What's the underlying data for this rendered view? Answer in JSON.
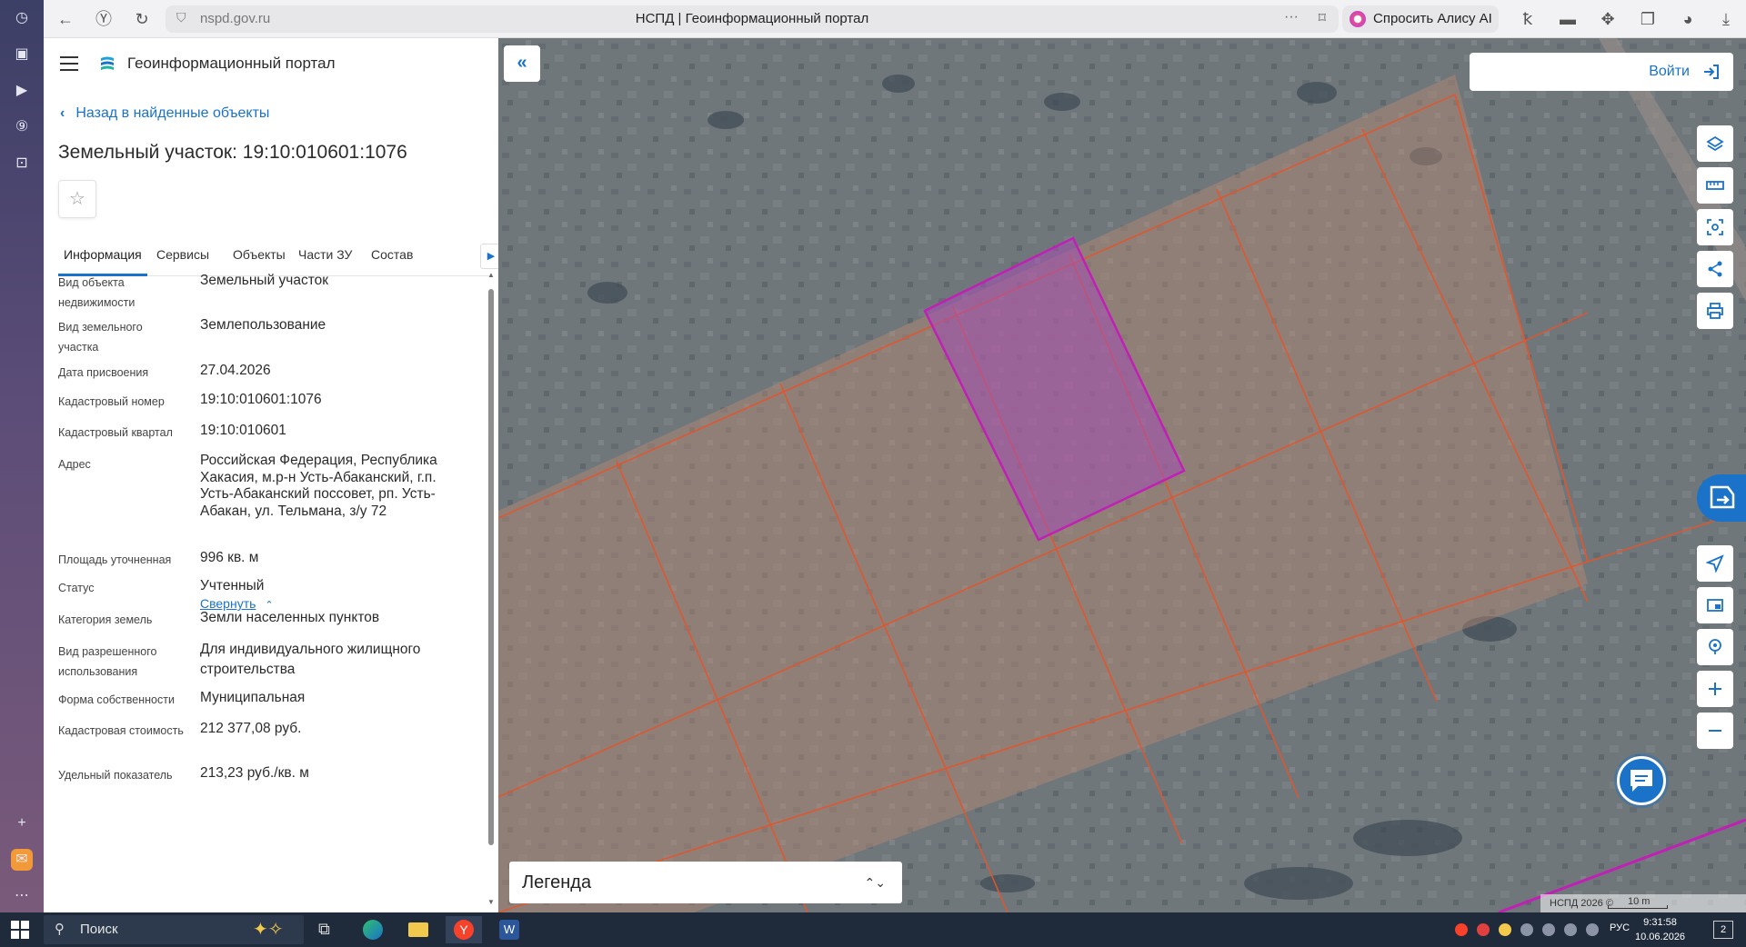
{
  "browser": {
    "url": "nspd.gov.ru",
    "page_title": "НСПД | Геоинформационный портал",
    "alisa_label": "Спросить Алису AI"
  },
  "panel": {
    "portal_name": "Геоинформационный портал",
    "back_link": "Назад в найденные объекты",
    "object_title": "Земельный участок: 19:10:010601:1076",
    "tabs": [
      "Информация",
      "Сервисы",
      "Объекты",
      "Части ЗУ",
      "Состав"
    ],
    "rows": [
      {
        "label": "Вид объекта недвижимости",
        "value": "Земельный участок"
      },
      {
        "label": "Вид земельного участка",
        "value": "Землепользование"
      },
      {
        "label": "Дата присвоения",
        "value": "27.04.2026"
      },
      {
        "label": "Кадастровый номер",
        "value": "19:10:010601:1076"
      },
      {
        "label": "Кадастровый квартал",
        "value": "19:10:010601"
      },
      {
        "label": "Адрес",
        "value": "Российская Федерация, Республика Хакасия, м.р-н Усть-Абаканский, г.п. Усть-Абаканский поссовет, рп. Усть-Абакан, ул. Тельмана, з/у 72"
      },
      {
        "label": "Площадь уточненная",
        "value": "996 кв. м"
      },
      {
        "label": "Статус",
        "value": "Учтенный"
      },
      {
        "label": "Категория земель",
        "value": "Земли населенных пунктов"
      },
      {
        "label": "Вид разрешенного использования",
        "value": "Для индивидуального жилищного строительства"
      },
      {
        "label": "Форма собственности",
        "value": "Муниципальная"
      },
      {
        "label": "Кадастровая стоимость",
        "value": "212 377,08 руб."
      },
      {
        "label": "Удельный показатель",
        "value": "213,23 руб./кв. м"
      }
    ],
    "collapse_link": "Свернуть"
  },
  "map": {
    "login_label": "Войти",
    "legend_label": "Легенда",
    "attribution": "НСПД 2026 ©",
    "scale_label": "10 m",
    "colors": {
      "parcel_outline": "#e2552d",
      "selected_outline": "#c11fb5",
      "accent": "#1a73c8"
    }
  },
  "taskbar": {
    "search_placeholder": "Поиск",
    "language": "РУС",
    "time": "9:31:58",
    "date": "10.06.2026",
    "notifications": "2"
  }
}
